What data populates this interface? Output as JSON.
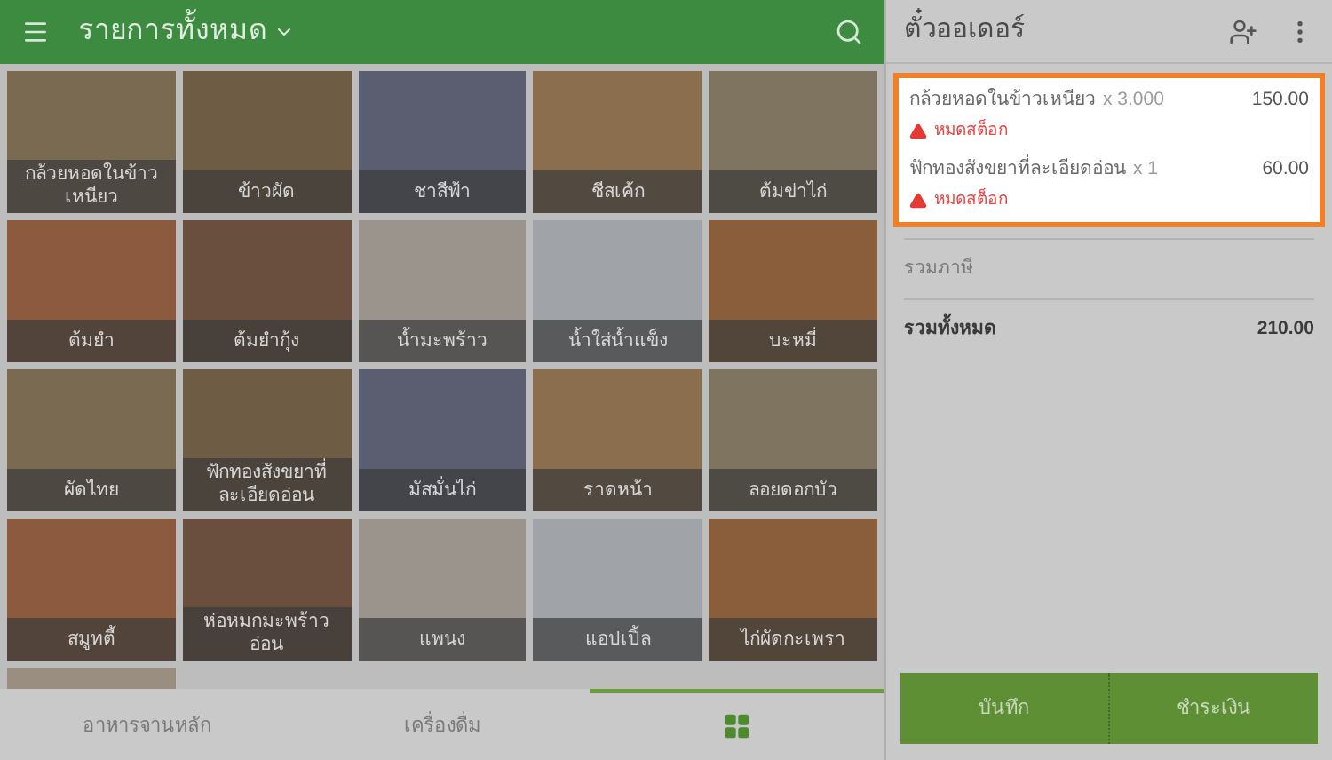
{
  "header": {
    "title": "รายการทั้งหมด"
  },
  "menu_items": [
    {
      "label": "กล้วยหอดในข้าวเหนียว"
    },
    {
      "label": "ข้าวผัด"
    },
    {
      "label": "ชาสีฟ้า"
    },
    {
      "label": "ชีสเค้ก"
    },
    {
      "label": "ต้มข่าไก่"
    },
    {
      "label": "ต้มยำ"
    },
    {
      "label": "ต้มยำกุ้ง"
    },
    {
      "label": "น้ำมะพร้าว"
    },
    {
      "label": "น้ำใส่น้ำแข็ง"
    },
    {
      "label": "บะหมี่"
    },
    {
      "label": "ผัดไทย"
    },
    {
      "label": "ฟักทองสังขยาที่ละเอียดอ่อน"
    },
    {
      "label": "มัสมั่นไก่"
    },
    {
      "label": "ราดหน้า"
    },
    {
      "label": "ลอยดอกบัว"
    },
    {
      "label": "สมูทตี้"
    },
    {
      "label": "ห่อหมกมะพร้าวอ่อน"
    },
    {
      "label": "แพนง"
    },
    {
      "label": "แอปเปิ้ล"
    },
    {
      "label": "ไก่ผัดกะเพรา"
    }
  ],
  "category_tabs": [
    {
      "kind": "text",
      "label": "อาหารจานหลัก",
      "selected": false
    },
    {
      "kind": "text",
      "label": "เครื่องดื่ม",
      "selected": false
    },
    {
      "kind": "icon",
      "selected": true
    }
  ],
  "order_panel": {
    "title": "ตั๋วออเดอร์",
    "items": [
      {
        "name": "กล้วยหอดในข้าวเหนียว",
        "quantity": "x 3.000",
        "price": "150.00",
        "warning": "หมดสต็อก"
      },
      {
        "name": "ฟักทองสังขยาที่ละเอียดอ่อน",
        "quantity": "x 1",
        "price": "60.00",
        "warning": "หมดสต็อก"
      }
    ],
    "tax_label": "รวมภาษี",
    "total_label": "รวมทั้งหมด",
    "total": "210.00",
    "buttons": [
      "บันทึก",
      "ชำระเงิน"
    ]
  }
}
